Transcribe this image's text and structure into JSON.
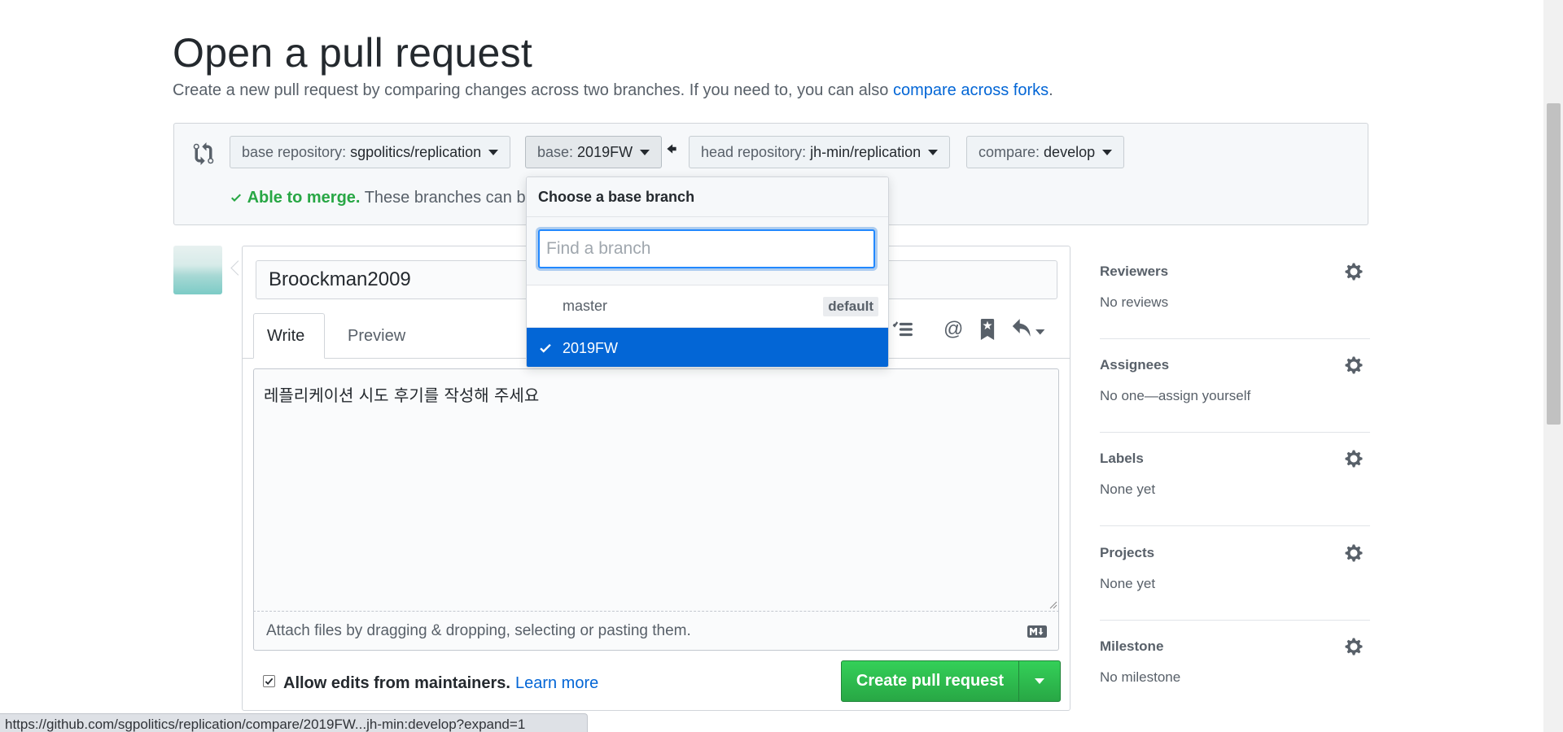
{
  "page": {
    "title": "Open a pull request",
    "description": "Create a new pull request by comparing changes across two branches. If you need to, you can also ",
    "description_link": "compare across forks",
    "description_end": "."
  },
  "range": {
    "base_repo_label": "base repository:",
    "base_repo_value": "sgpolitics/replication",
    "base_label": "base:",
    "base_value": "2019FW",
    "head_repo_label": "head repository:",
    "head_repo_value": "jh-min/replication",
    "compare_label": "compare:",
    "compare_value": "develop",
    "merge_ok": "Able to merge.",
    "merge_text": "These branches can b"
  },
  "form": {
    "title_value": "Broockman2009",
    "tab_write": "Write",
    "tab_preview": "Preview",
    "body_value": "레플리케이션 시도 후기를 작성해 주세요",
    "attach_text": "Attach files by dragging & dropping, selecting or pasting them.",
    "allow_edits_label": "Allow edits from maintainers.",
    "learn_more": "Learn more",
    "create_button": "Create pull request"
  },
  "dropdown": {
    "header": "Choose a base branch",
    "filter_placeholder": "Find a branch",
    "branches": [
      {
        "name": "master",
        "badge": "default",
        "selected": false
      },
      {
        "name": "2019FW",
        "badge": "",
        "selected": true
      }
    ]
  },
  "sidebar": [
    {
      "title": "Reviewers",
      "value": "No reviews"
    },
    {
      "title": "Assignees",
      "value": "No one—assign yourself"
    },
    {
      "title": "Labels",
      "value": "None yet"
    },
    {
      "title": "Projects",
      "value": "None yet"
    },
    {
      "title": "Milestone",
      "value": "No milestone"
    }
  ],
  "status_bar": {
    "url": "https://github.com/sgpolitics/replication/compare/2019FW...jh-min:develop?expand=1"
  },
  "colors": {
    "link": "#0366d6",
    "success": "#28a745",
    "selected_bg": "#0366d6"
  }
}
